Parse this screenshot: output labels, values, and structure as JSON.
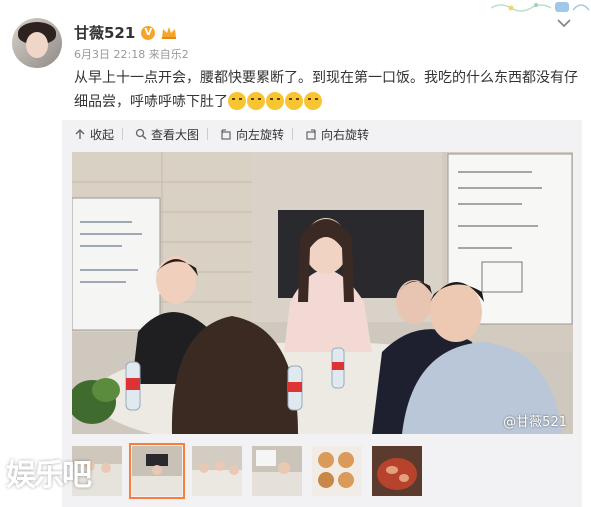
{
  "post": {
    "author": "甘薇521",
    "date": "6月3日 22:18",
    "source": "来自乐2",
    "text": "从早上十一点开会，腰都快要累断了。到现在第一口饭。我吃的什么东西都没有仔细品尝，呼哧呼哧下肚了",
    "emoji_count": 5
  },
  "toolbar": {
    "collapse_label": "收起",
    "view_large_label": "查看大图",
    "rotate_left_label": "向左旋转",
    "rotate_right_label": "向右旋转"
  },
  "photo": {
    "watermark": "@甘薇521",
    "selected_thumbnail_index": 1
  },
  "thumbnails_count": 6,
  "site_logo": "娱乐吧",
  "colors": {
    "accent": "#fa7d3c",
    "toolbar_bg": "#f2f2f5",
    "meta_text": "#999999",
    "vip_badge": "#f7a52a"
  }
}
